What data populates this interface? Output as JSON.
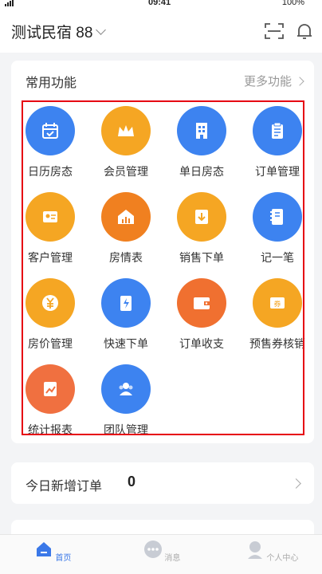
{
  "status_bar": {
    "time": "09:41",
    "battery": "100%"
  },
  "header": {
    "title": "测试民宿 88"
  },
  "common_functions": {
    "title": "常用功能",
    "more_label": "更多功能",
    "items": [
      {
        "label": "日历房态",
        "icon": "calendar-check-icon",
        "color": "#3d83f0"
      },
      {
        "label": "会员管理",
        "icon": "crown-icon",
        "color": "#f5a623"
      },
      {
        "label": "单日房态",
        "icon": "building-icon",
        "color": "#3d83f0"
      },
      {
        "label": "订单管理",
        "icon": "clipboard-icon",
        "color": "#3d83f0"
      },
      {
        "label": "客户管理",
        "icon": "guest-card-icon",
        "color": "#f5a623"
      },
      {
        "label": "房情表",
        "icon": "house-chart-icon",
        "color": "#f08020"
      },
      {
        "label": "销售下单",
        "icon": "sales-order-icon",
        "color": "#f5a623"
      },
      {
        "label": "记一笔",
        "icon": "notebook-icon",
        "color": "#3d83f0"
      },
      {
        "label": "房价管理",
        "icon": "yen-icon",
        "color": "#f5a623"
      },
      {
        "label": "快速下单",
        "icon": "quick-order-icon",
        "color": "#3d83f0"
      },
      {
        "label": "订单收支",
        "icon": "wallet-icon",
        "color": "#f07030"
      },
      {
        "label": "预售券核销",
        "icon": "coupon-icon",
        "color": "#f5a623"
      },
      {
        "label": "统计报表",
        "icon": "report-chart-icon",
        "color": "#f07040"
      },
      {
        "label": "团队管理",
        "icon": "team-icon",
        "color": "#3d83f0"
      }
    ]
  },
  "today_orders": {
    "label": "今日新增订单",
    "count": "0"
  },
  "tabbar": {
    "tabs": [
      {
        "label": "首页",
        "icon": "home-icon",
        "active": true
      },
      {
        "label": "消息",
        "icon": "message-icon",
        "active": false
      },
      {
        "label": "个人中心",
        "icon": "profile-icon",
        "active": false
      }
    ]
  },
  "colors": {
    "accent": "#3a78e8",
    "highlight_border": "#e60012"
  }
}
